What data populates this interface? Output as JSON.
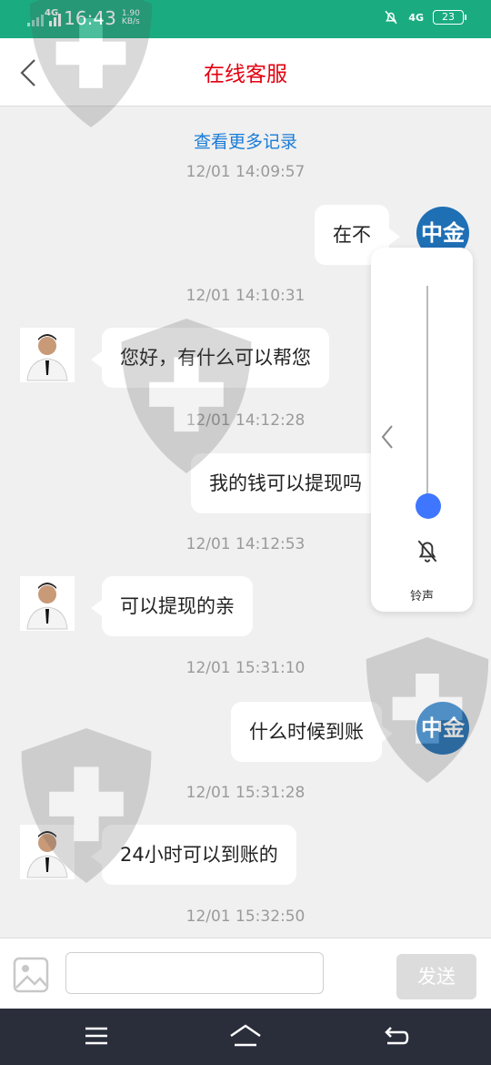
{
  "status_bar": {
    "network": "4G",
    "time": "16:43",
    "speed_value": "1.90",
    "speed_unit": "KB/s",
    "network_right": "4G",
    "battery": "23"
  },
  "header": {
    "title": "在线客服"
  },
  "chat": {
    "load_more": "查看更多记录",
    "timestamps": [
      "12/01 14:09:57",
      "12/01 14:10:31",
      "12/01 14:12:28",
      "12/01 14:12:53",
      "12/01 15:31:10",
      "12/01 15:31:28",
      "12/01 15:32:50"
    ],
    "messages": [
      {
        "side": "right",
        "text": "在不"
      },
      {
        "side": "left",
        "text": "您好，有什么可以帮您"
      },
      {
        "side": "right",
        "text": "我的钱可以提现吗"
      },
      {
        "side": "left",
        "text": "可以提现的亲"
      },
      {
        "side": "right",
        "text": "什么时候到账"
      },
      {
        "side": "left",
        "text": "24小时可以到账的"
      }
    ],
    "user_avatar_text": "中金"
  },
  "volume_panel": {
    "label": "铃声",
    "level": 0.0
  },
  "input_bar": {
    "placeholder": "",
    "send_label": "发送"
  },
  "colors": {
    "status_bar": "#1aac80",
    "title": "#e3000f",
    "link": "#1a7cd6",
    "knob": "#3f76ff",
    "nav_bar": "#2a2d3a"
  }
}
